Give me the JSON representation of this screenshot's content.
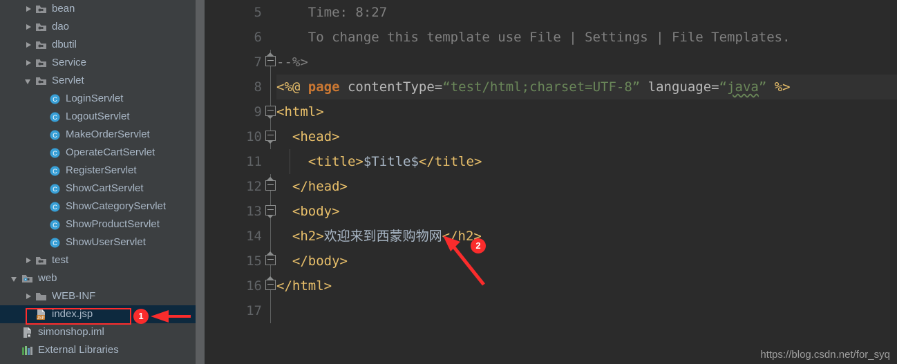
{
  "sidebar": {
    "items": [
      {
        "label": "bean",
        "indent": 1,
        "arrow": "collapsed",
        "icon": "folder-module-icon"
      },
      {
        "label": "dao",
        "indent": 1,
        "arrow": "collapsed",
        "icon": "folder-module-icon"
      },
      {
        "label": "dbutil",
        "indent": 1,
        "arrow": "collapsed",
        "icon": "folder-module-icon"
      },
      {
        "label": "Service",
        "indent": 1,
        "arrow": "collapsed",
        "icon": "folder-module-icon"
      },
      {
        "label": "Servlet",
        "indent": 1,
        "arrow": "expanded",
        "icon": "folder-module-icon"
      },
      {
        "label": "LoginServlet",
        "indent": 2,
        "arrow": "none",
        "icon": "java-class-icon"
      },
      {
        "label": "LogoutServlet",
        "indent": 2,
        "arrow": "none",
        "icon": "java-class-icon"
      },
      {
        "label": "MakeOrderServlet",
        "indent": 2,
        "arrow": "none",
        "icon": "java-class-icon"
      },
      {
        "label": "OperateCartServlet",
        "indent": 2,
        "arrow": "none",
        "icon": "java-class-icon"
      },
      {
        "label": "RegisterServlet",
        "indent": 2,
        "arrow": "none",
        "icon": "java-class-icon"
      },
      {
        "label": "ShowCartServlet",
        "indent": 2,
        "arrow": "none",
        "icon": "java-class-icon"
      },
      {
        "label": "ShowCategoryServlet",
        "indent": 2,
        "arrow": "none",
        "icon": "java-class-icon"
      },
      {
        "label": "ShowProductServlet",
        "indent": 2,
        "arrow": "none",
        "icon": "java-class-icon"
      },
      {
        "label": "ShowUserServlet",
        "indent": 2,
        "arrow": "none",
        "icon": "java-class-icon"
      },
      {
        "label": "test",
        "indent": 1,
        "arrow": "collapsed",
        "icon": "folder-module-icon"
      },
      {
        "label": "web",
        "indent": 0,
        "arrow": "expanded",
        "icon": "folder-web-icon"
      },
      {
        "label": "WEB-INF",
        "indent": 1,
        "arrow": "collapsed",
        "icon": "folder-icon"
      },
      {
        "label": "index.jsp",
        "indent": 1,
        "arrow": "none",
        "icon": "jsp-file-icon",
        "selected": true
      },
      {
        "label": "simonshop.iml",
        "indent": 0,
        "arrow": "none",
        "icon": "iml-file-icon"
      },
      {
        "label": "External Libraries",
        "indent": 0,
        "arrow": "none",
        "icon": "external-libraries-icon"
      }
    ]
  },
  "editor": {
    "lines": [
      {
        "number": "5",
        "fold": "none",
        "foldline": false,
        "indent_guide": false,
        "tokens": [
          {
            "text": "    Time: 8:27",
            "cls": "t-comment"
          }
        ]
      },
      {
        "number": "6",
        "fold": "none",
        "foldline": false,
        "indent_guide": false,
        "tokens": [
          {
            "text": "    To change this template use File | Settings | File Templates.",
            "cls": "t-comment"
          }
        ]
      },
      {
        "number": "7",
        "fold": "end-top",
        "foldline": true,
        "indent_guide": false,
        "tokens": [
          {
            "text": "--%>",
            "cls": "t-comment"
          }
        ]
      },
      {
        "number": "8",
        "fold": "none",
        "foldline": true,
        "indent_guide": false,
        "caret": true,
        "tokens": [
          {
            "text": "<%@ ",
            "cls": "t-tag"
          },
          {
            "text": "page",
            "cls": "t-kw"
          },
          {
            "text": " contentType=",
            "cls": "t-attr"
          },
          {
            "text": "“test/html;charset=UTF-8”",
            "cls": "t-string"
          },
          {
            "text": " language=",
            "cls": "t-attr"
          },
          {
            "text": "“",
            "cls": "t-string"
          },
          {
            "text": "java",
            "cls": "t-string squiggle"
          },
          {
            "text": "”",
            "cls": "t-string"
          },
          {
            "text": " %>",
            "cls": "t-tag"
          }
        ]
      },
      {
        "number": "9",
        "fold": "start",
        "foldline": false,
        "indent_guide": false,
        "tokens": [
          {
            "text": "<html>",
            "cls": "t-tag"
          }
        ]
      },
      {
        "number": "10",
        "fold": "start",
        "foldline": false,
        "indent_guide": false,
        "tokens": [
          {
            "text": "  <head>",
            "cls": "t-tag"
          }
        ]
      },
      {
        "number": "11",
        "fold": "none",
        "foldline": false,
        "indent_guide": true,
        "tokens": [
          {
            "text": "    <title>",
            "cls": "t-tag"
          },
          {
            "text": "$Title$",
            "cls": "t-text"
          },
          {
            "text": "</title>",
            "cls": "t-tag"
          }
        ]
      },
      {
        "number": "12",
        "fold": "end-top",
        "foldline": false,
        "indent_guide": false,
        "tokens": [
          {
            "text": "  </head>",
            "cls": "t-tag"
          }
        ]
      },
      {
        "number": "13",
        "fold": "start",
        "foldline": false,
        "indent_guide": false,
        "tokens": [
          {
            "text": "  <body>",
            "cls": "t-tag"
          }
        ]
      },
      {
        "number": "14",
        "fold": "none",
        "foldline": true,
        "indent_guide": false,
        "tokens": [
          {
            "text": "  <h2>",
            "cls": "t-tag"
          },
          {
            "text": "欢迎来到西蒙购物网",
            "cls": "t-text"
          },
          {
            "text": "</h2>",
            "cls": "t-tag"
          }
        ]
      },
      {
        "number": "15",
        "fold": "end-top",
        "foldline": true,
        "indent_guide": false,
        "tokens": [
          {
            "text": "  </body>",
            "cls": "t-tag"
          }
        ]
      },
      {
        "number": "16",
        "fold": "end-top",
        "foldline": true,
        "indent_guide": false,
        "tokens": [
          {
            "text": "</html>",
            "cls": "t-tag"
          }
        ]
      },
      {
        "number": "17",
        "fold": "none",
        "foldline": true,
        "indent_guide": false,
        "tokens": [
          {
            "text": "",
            "cls": "t-plain"
          }
        ]
      }
    ],
    "watermark": "https://blog.csdn.net/for_syq"
  },
  "annotations": {
    "badge_one": "1",
    "badge_two": "2",
    "accent_color": "#fa2c2c"
  }
}
